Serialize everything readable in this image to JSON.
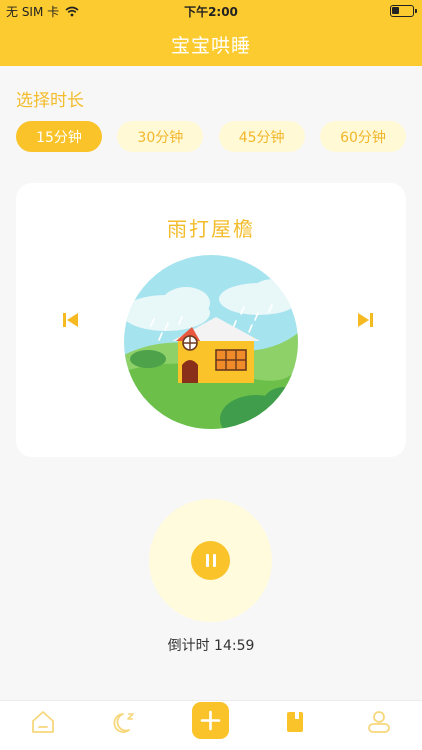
{
  "status_bar": {
    "carrier": "无 SIM 卡",
    "time": "下午2:00"
  },
  "nav": {
    "title": "宝宝哄睡"
  },
  "duration": {
    "title": "选择时长",
    "options": [
      "15分钟",
      "30分钟",
      "45分钟",
      "60分钟"
    ],
    "selected": "15分钟"
  },
  "player": {
    "track_title": "雨打屋檐",
    "countdown": "倒计时 14:59"
  },
  "colors": {
    "primary": "#fbcb2f",
    "accent_text": "#f3bc2a",
    "chip_bg": "#fff9d6"
  },
  "tabbar": {
    "icons": [
      "home-icon",
      "moon-sleep-icon",
      "plus-icon",
      "book-icon",
      "profile-icon"
    ]
  }
}
